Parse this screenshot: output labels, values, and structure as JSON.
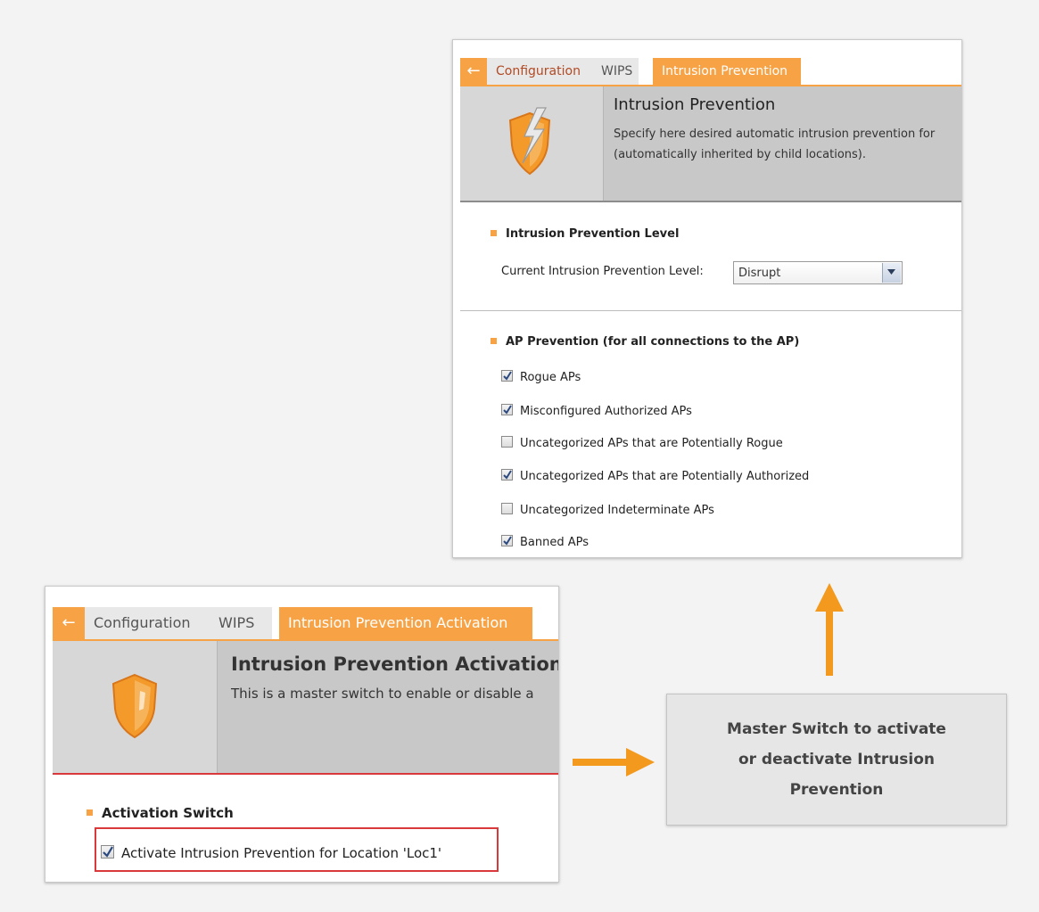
{
  "top_panel": {
    "tabs": [
      {
        "label": "Configuration"
      },
      {
        "label": "WIPS"
      },
      {
        "label": "Intrusion Prevention"
      }
    ],
    "header": {
      "title": "Intrusion Prevention",
      "desc_line1": "Specify here desired automatic intrusion prevention for",
      "desc_line2": "(automatically inherited by child locations)."
    },
    "level_section": {
      "heading": "Intrusion Prevention Level",
      "field_label": "Current Intrusion Prevention Level:",
      "selected": "Disrupt"
    },
    "ap_section": {
      "heading": "AP Prevention (for all connections to the AP)",
      "items": [
        {
          "label": "Rogue APs",
          "checked": true
        },
        {
          "label": "Misconfigured Authorized APs",
          "checked": true
        },
        {
          "label": "Uncategorized APs that are Potentially Rogue",
          "checked": false
        },
        {
          "label": "Uncategorized APs that are Potentially Authorized",
          "checked": true
        },
        {
          "label": "Uncategorized Indeterminate APs",
          "checked": false
        },
        {
          "label": "Banned APs",
          "checked": true
        }
      ]
    }
  },
  "callout": {
    "line1": "Master Switch to activate",
    "line2": "or deactivate Intrusion",
    "line3": "Prevention"
  },
  "bottom_panel": {
    "tabs": [
      {
        "label": "Configuration"
      },
      {
        "label": "WIPS"
      },
      {
        "label": "Intrusion Prevention Activation"
      }
    ],
    "header": {
      "title": "Intrusion Prevention Activation",
      "desc": "This is a master switch to enable or disable a"
    },
    "activation": {
      "heading": "Activation Switch",
      "checkbox_label": "Activate Intrusion Prevention for Location 'Loc1'",
      "checked": true
    }
  },
  "colors": {
    "accent": "#f7a245",
    "highlight_red": "#d9393b",
    "crumb_link": "#b24a24"
  }
}
